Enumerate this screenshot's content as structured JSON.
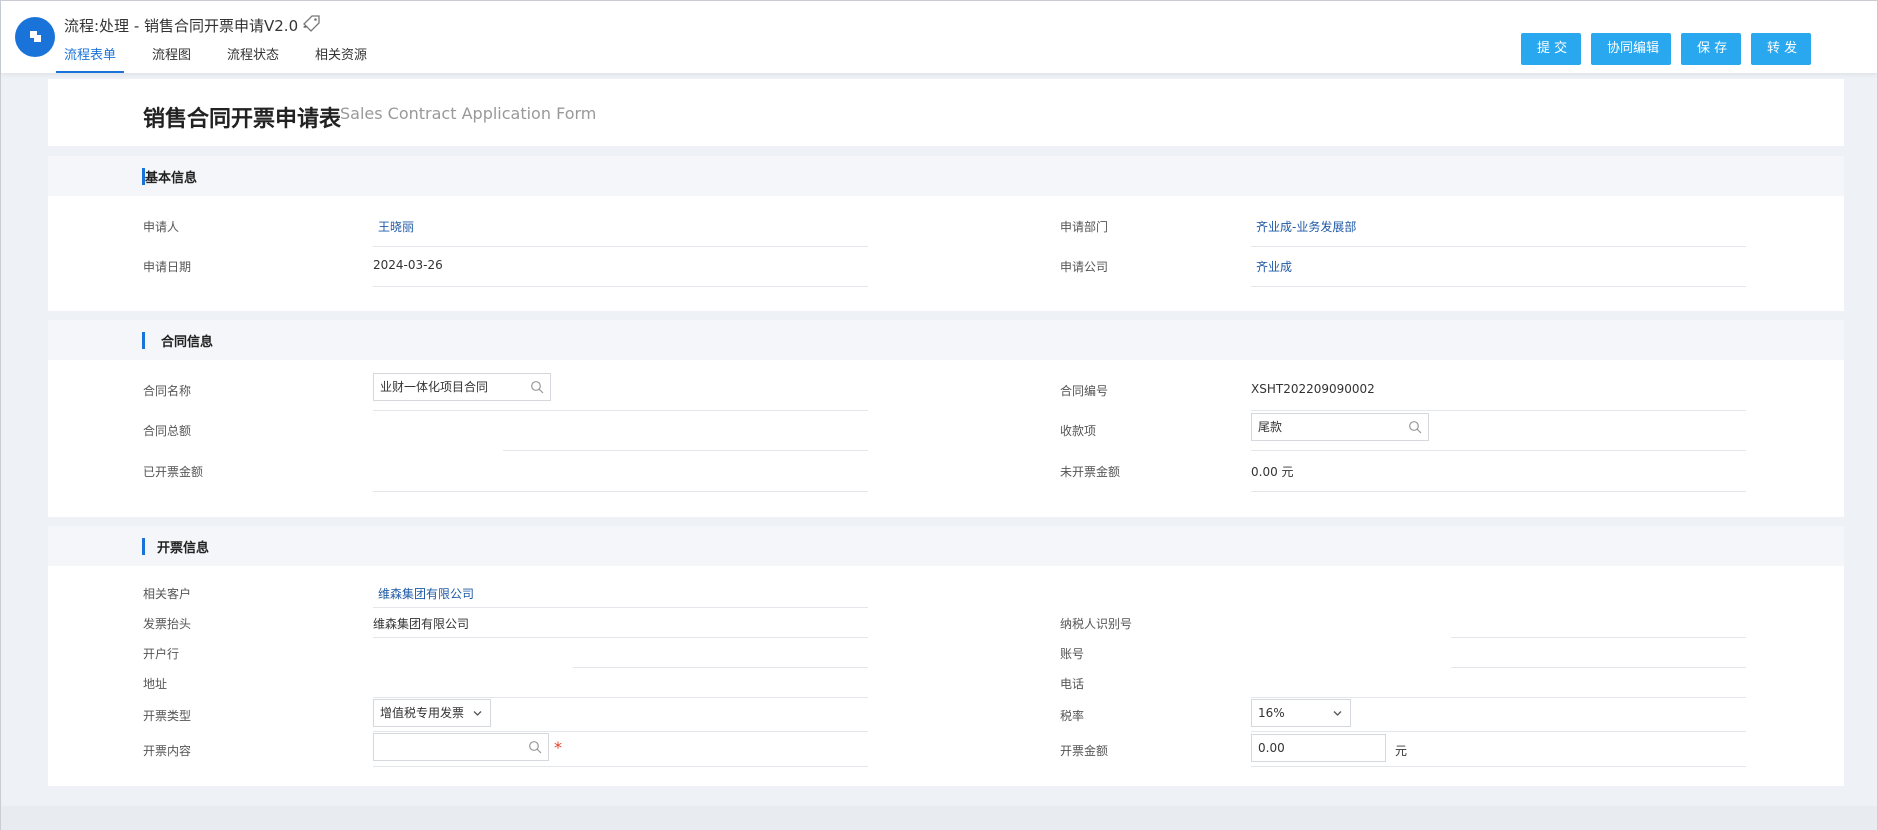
{
  "header": {
    "title": "流程:处理 - 销售合同开票申请V2.0 -",
    "tabs": [
      {
        "label": "流程表单",
        "active": true
      },
      {
        "label": "流程图",
        "active": false
      },
      {
        "label": "流程状态",
        "active": false
      },
      {
        "label": "相关资源",
        "active": false
      }
    ],
    "buttons": {
      "submit": "提 交",
      "collab_edit": "协同编辑",
      "save": "保 存",
      "forward": "转 发"
    },
    "accent_color": "#29a8f0",
    "logo_color": "#1a73d9"
  },
  "form": {
    "title": "销售合同开票申请表",
    "subtitle": "Sales Contract Application Form"
  },
  "basic": {
    "section_title": "基本信息",
    "applicant_label": "申请人",
    "applicant_value": "王晓丽",
    "department_label": "申请部门",
    "department_value": "齐业成-业务发展部",
    "date_label": "申请日期",
    "date_value": "2024-03-26",
    "company_label": "申请公司",
    "company_value": "齐业成"
  },
  "contract": {
    "section_title": "合同信息",
    "name_label": "合同名称",
    "name_value": "业财一体化项目合同",
    "number_label": "合同编号",
    "number_value": "XSHT202209090002",
    "total_label": "合同总额",
    "total_value": "",
    "payment_item_label": "收款项",
    "payment_item_value": "尾款",
    "invoiced_label": "已开票金额",
    "invoiced_value": "",
    "uninvoiced_label": "未开票金额",
    "uninvoiced_value": "0.00 元"
  },
  "invoice": {
    "section_title": "开票信息",
    "customer_label": "相关客户",
    "customer_value": "维森集团有限公司",
    "header_label": "发票抬头",
    "header_value": "维森集团有限公司",
    "taxpayer_id_label": "纳税人识别号",
    "taxpayer_id_value": "",
    "bank_label": "开户行",
    "bank_value": "",
    "account_label": "账号",
    "account_value": "",
    "address_label": "地址",
    "address_value": "",
    "phone_label": "电话",
    "phone_value": "",
    "type_label": "开票类型",
    "type_value": "增值税专用发票",
    "tax_rate_label": "税率",
    "tax_rate_value": "16%",
    "content_label": "开票内容",
    "content_value": "",
    "required_mark": "*",
    "amount_label": "开票金额",
    "amount_value": "0.00",
    "amount_unit": "元"
  }
}
